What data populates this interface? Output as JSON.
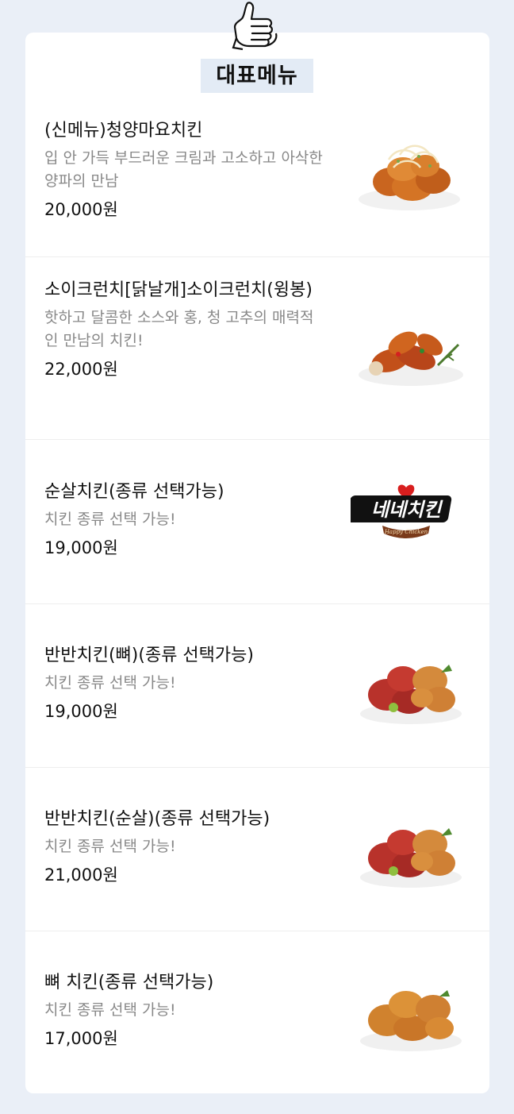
{
  "section": {
    "title": "대표메뉴",
    "icon": "thumbs-up-icon"
  },
  "items": [
    {
      "name": "(신메뉴)청양마요치킨",
      "desc": "입 안 가득 부드러운 크림과 고소하고 아삭한 양파의 만남",
      "price": "20,000원",
      "image": "chicken-mayo-onion"
    },
    {
      "name": "소이크런치[닭날개]소이크런치(윙봉)",
      "desc": "핫하고 달콤한 소스와 홍, 청 고추의 매력적인 만남의 치킨!",
      "price": "22,000원",
      "image": "soy-wings"
    },
    {
      "name": "순살치킨(종류 선택가능)",
      "desc": "치킨 종류 선택 가능!",
      "price": "19,000원",
      "image": "nene-logo",
      "logo_text": "네네치킨",
      "logo_sub": "Happy Chicken"
    },
    {
      "name": "반반치킨(뼈)(종류 선택가능)",
      "desc": "치킨 종류 선택 가능!",
      "price": "19,000원",
      "image": "half-half-chicken"
    },
    {
      "name": "반반치킨(순살)(종류 선택가능)",
      "desc": "치킨 종류 선택 가능!",
      "price": "21,000원",
      "image": "half-half-boneless"
    },
    {
      "name": "뼈 치킨(종류 선택가능)",
      "desc": "치킨 종류 선택 가능!",
      "price": "17,000원",
      "image": "fried-chicken"
    }
  ]
}
